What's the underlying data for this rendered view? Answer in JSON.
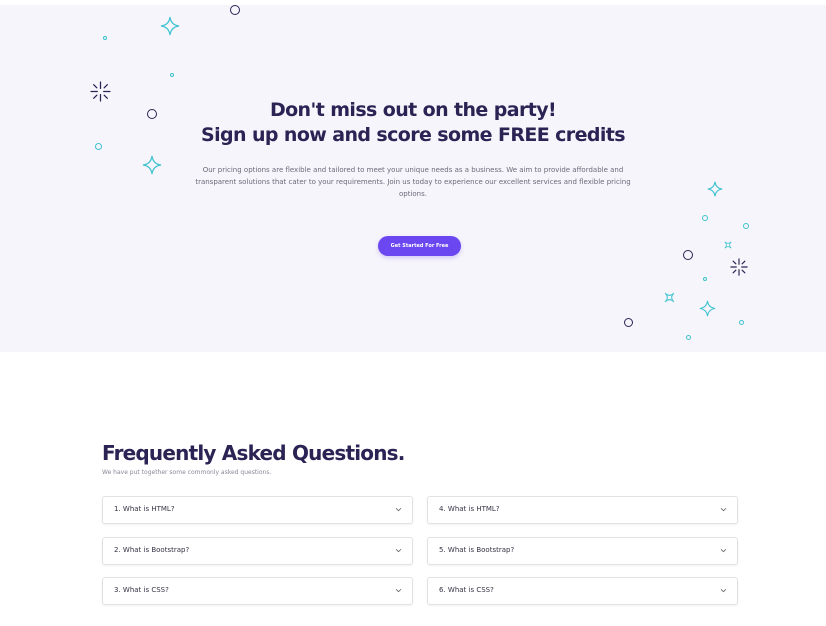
{
  "hero": {
    "title_line1": "Don't miss out on the party!",
    "title_line2": "Sign up now and score some FREE credits",
    "description_line1": "Our pricing options are flexible and tailored to meet your unique needs as a business. We aim to provide affordable and",
    "description_line2": "transparent solutions that cater to your requirements. Join us today to experience our excellent services and flexible pricing options.",
    "cta_label": "Get Started For Free"
  },
  "faq": {
    "title": "Frequently Asked Questions.",
    "subtitle": "We have put together some commonly asked questions.",
    "items": [
      {
        "question": "1. What is HTML?"
      },
      {
        "question": "2. What is Bootstrap?"
      },
      {
        "question": "3. What is CSS?"
      },
      {
        "question": "4. What is HTML?"
      },
      {
        "question": "5. What is Bootstrap?"
      },
      {
        "question": "6. What is CSS?"
      }
    ]
  },
  "colors": {
    "accent": "#6a47f0",
    "heading": "#2a2354",
    "hero_background": "#f6f5fb",
    "decor_teal": "#3ec3cf"
  },
  "icons": {
    "faq_expand": "chevron-down-icon",
    "decorations": [
      "sparkle-star-icon",
      "ring-icon",
      "burst-icon",
      "square-sparkle-icon"
    ]
  }
}
